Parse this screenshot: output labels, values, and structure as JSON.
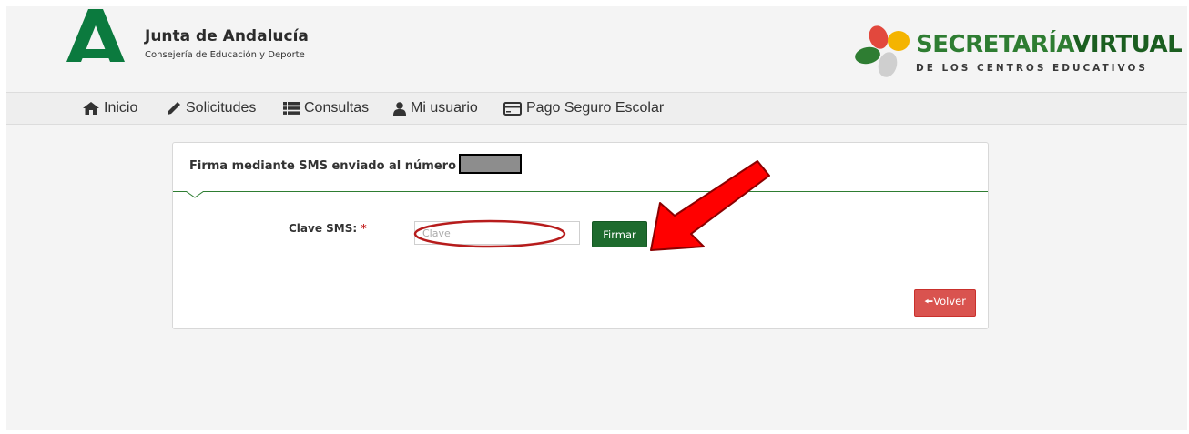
{
  "header": {
    "org_title": "Junta de Andalucía",
    "org_subtitle": "Consejería de Educación y Deporte",
    "app_title_part1": "SECRETARÍA",
    "app_title_part2": "VIRTUAL",
    "app_subtitle": "DE LOS CENTROS EDUCATIVOS"
  },
  "nav": {
    "items": [
      {
        "label": "Inicio",
        "icon": "home-icon"
      },
      {
        "label": "Solicitudes",
        "icon": "pencil-icon"
      },
      {
        "label": "Consultas",
        "icon": "list-icon"
      },
      {
        "label": "Mi usuario",
        "icon": "user-icon"
      },
      {
        "label": "Pago Seguro Escolar",
        "icon": "credit-card-icon"
      }
    ]
  },
  "panel": {
    "title": "Firma mediante SMS enviado al número 6",
    "field_label": "Clave SMS:",
    "required_mark": "*",
    "input_placeholder": "Clave",
    "input_value": "",
    "submit_label": "Firmar",
    "back_label": "Volver"
  },
  "colors": {
    "brand_green": "#1e6b2e",
    "danger_red": "#d9534f",
    "annotation_red": "#ff0000"
  }
}
